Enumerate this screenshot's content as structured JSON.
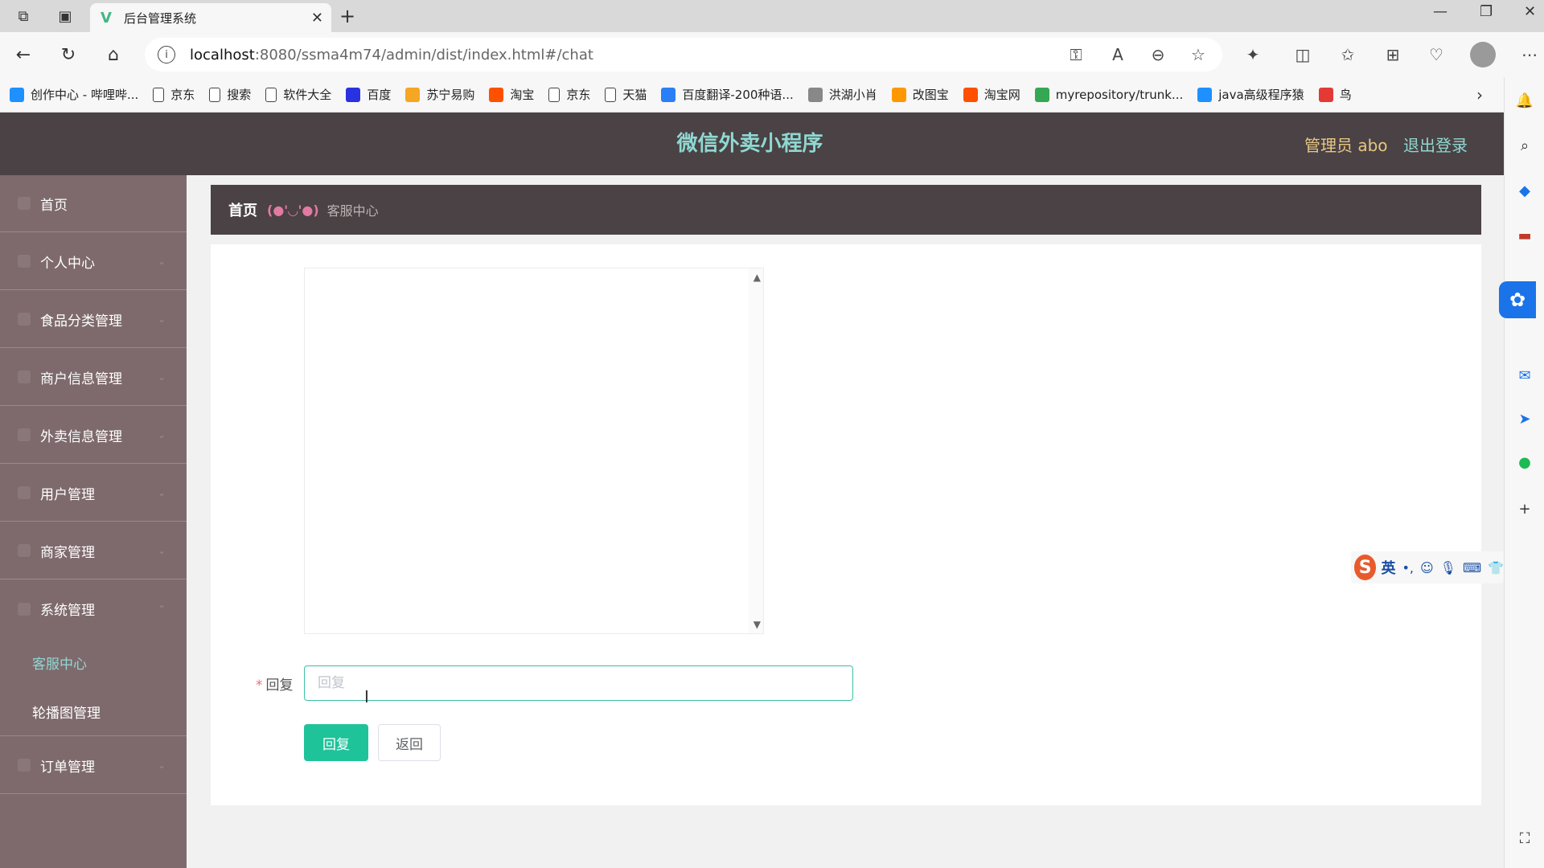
{
  "browser": {
    "tab_title": "后台管理系统",
    "url_host": "localhost",
    "url_rest": ":8080/ssma4m74/admin/dist/index.html#/chat",
    "bookmarks": [
      {
        "label": "创作中心 - 哔哩哔...",
        "icon": "bilibili-icon",
        "color": "#1e90ff"
      },
      {
        "label": "京东",
        "icon": "page-icon",
        "color": "#ffffff"
      },
      {
        "label": "搜索",
        "icon": "page-icon",
        "color": "#ffffff"
      },
      {
        "label": "软件大全",
        "icon": "page-icon",
        "color": "#ffffff"
      },
      {
        "label": "百度",
        "icon": "baidu-icon",
        "color": "#2932e1"
      },
      {
        "label": "苏宁易购",
        "icon": "suning-icon",
        "color": "#f5a623"
      },
      {
        "label": "淘宝",
        "icon": "taobao-icon",
        "color": "#ff5000"
      },
      {
        "label": "京东",
        "icon": "page-icon",
        "color": "#ffffff"
      },
      {
        "label": "天猫",
        "icon": "page-icon",
        "color": "#ffffff"
      },
      {
        "label": "百度翻译-200种语...",
        "icon": "translate-icon",
        "color": "#2a7ff7"
      },
      {
        "label": "洪湖小肖",
        "icon": "bird-icon",
        "color": "#888888"
      },
      {
        "label": "改图宝",
        "icon": "gaitubao-icon",
        "color": "#ff9800"
      },
      {
        "label": "淘宝网",
        "icon": "taobao-icon",
        "color": "#ff5000"
      },
      {
        "label": "myrepository/trunk...",
        "icon": "chrome-icon",
        "color": "#34a853"
      },
      {
        "label": "java高级程序猿",
        "icon": "bilibili-icon",
        "color": "#1e90ff"
      },
      {
        "label": "鸟",
        "icon": "bird-icon",
        "color": "#e53935"
      }
    ]
  },
  "app": {
    "title": "微信外卖小程序",
    "admin_label": "管理员 abo",
    "logout_label": "退出登录"
  },
  "sidebar": {
    "items": [
      {
        "label": "首页"
      },
      {
        "label": "个人中心"
      },
      {
        "label": "食品分类管理"
      },
      {
        "label": "商户信息管理"
      },
      {
        "label": "外卖信息管理"
      },
      {
        "label": "用户管理"
      },
      {
        "label": "商家管理"
      },
      {
        "label": "系统管理"
      },
      {
        "label": "订单管理"
      }
    ],
    "sub_items": [
      {
        "label": "客服中心",
        "active": true,
        "color": "#8fd8d2"
      },
      {
        "label": "轮播图管理",
        "active": false,
        "color": "#ffffff"
      }
    ]
  },
  "breadcrumb": {
    "home": "首页",
    "face": "(●'◡'●)",
    "current": "客服中心"
  },
  "form": {
    "reply_label": "回复",
    "reply_placeholder": "回复",
    "reply_value": "",
    "submit_label": "回复",
    "back_label": "返回"
  },
  "ime": {
    "mode": "英"
  },
  "colors": {
    "header_bg": "#4a4244",
    "sidebar_bg": "#7e6a6d",
    "accent": "#1fc39a",
    "title_color": "#8fd8d2",
    "admin_color": "#e8c783"
  }
}
